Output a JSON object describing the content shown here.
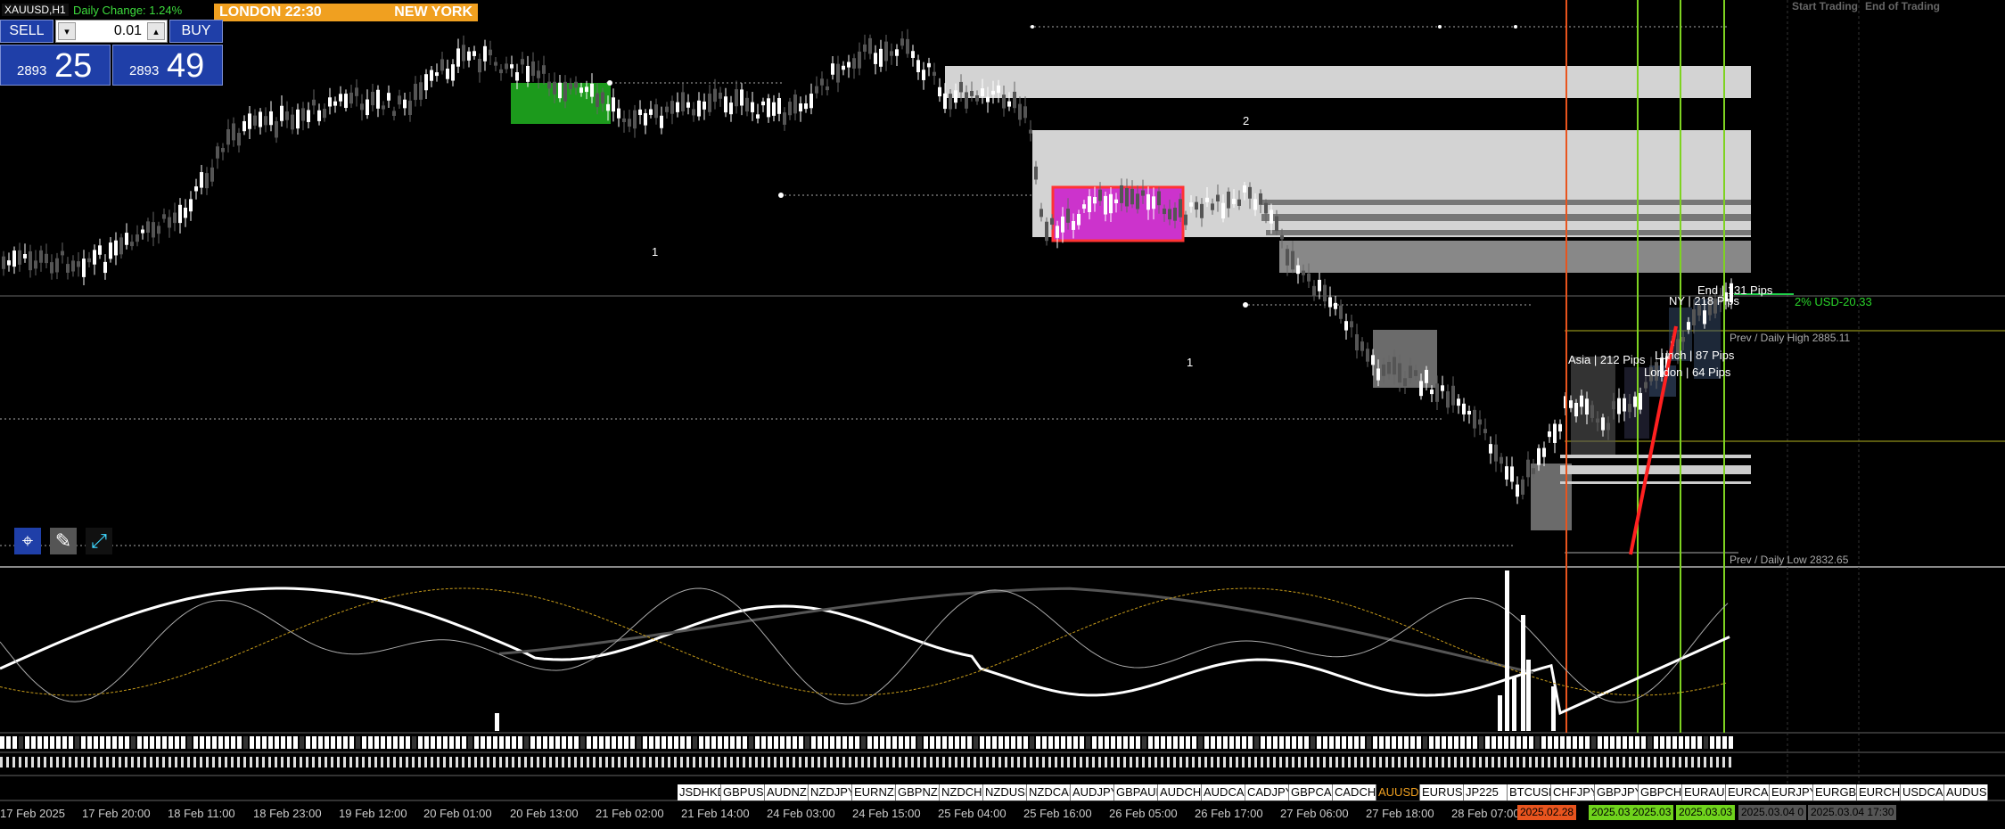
{
  "header": {
    "symbol": "XAUUSD,H1",
    "daily_change": "Daily Change: 1.24%",
    "session_left": "LONDON 22:30",
    "session_right": "NEW YORK"
  },
  "trade_panel": {
    "sell_label": "SELL",
    "buy_label": "BUY",
    "lot_value": "0.01",
    "down_glyph": "▾",
    "up_glyph": "▴",
    "sell_price_small": "2893",
    "sell_price_big": "25",
    "buy_price_small": "2893",
    "buy_price_big": "49"
  },
  "session_headers": {
    "start": "Start Trading",
    "end": "End of Trading"
  },
  "chart_labels": {
    "zone_number_1": "2",
    "zone_number_2": "1",
    "zone_number_3": "1",
    "asia": "Asia | 212 Pips",
    "london": "London | 64 Pips",
    "lunch": "Lunch | 87 Pips",
    "ny": "NY | 218 Pips",
    "end": "End | 131 Pips",
    "risk": "2% USD-20.33",
    "prev_high": "Prev / Daily High 2885.11",
    "prev_low": "Prev / Daily Low 2832.65"
  },
  "tools": [
    {
      "name": "crosshair-icon",
      "glyph": "⌖"
    },
    {
      "name": "draw-tool-icon",
      "glyph": "✎"
    },
    {
      "name": "chart-expand-icon",
      "glyph": "⤢"
    }
  ],
  "pairs": [
    "JSDHKD",
    "GBPUSD",
    "AUDNZD",
    "NZDJPY",
    "EURNZD",
    "GBPNZD",
    "NZDCHF",
    "NZDUSD",
    "NZDCAD",
    "AUDJPY",
    "GBPAUD",
    "AUDCHF",
    "AUDCAD",
    "CADJPY",
    "GBPCAD",
    "CADCHF",
    "AUUSD",
    "EURUSD",
    "JP225",
    "BTCUSD",
    "CHFJPY",
    "GBPJPY",
    "GBPCHF",
    "EURAUD",
    "EURCAD",
    "EURJPY",
    "EURGBP",
    "EURCHF",
    "USDCAD",
    "AUDUSD"
  ],
  "active_pair": "AUUSD",
  "time_axis": [
    "17 Feb 2025",
    "17 Feb 20:00",
    "18 Feb 11:00",
    "18 Feb 23:00",
    "19 Feb 12:00",
    "20 Feb 01:00",
    "20 Feb 13:00",
    "21 Feb 02:00",
    "21 Feb 14:00",
    "24 Feb 03:00",
    "24 Feb 15:00",
    "25 Feb 04:00",
    "25 Feb 16:00",
    "26 Feb 05:00",
    "26 Feb 17:00",
    "27 Feb 06:00",
    "27 Feb 18:00",
    "28 Feb 07:00"
  ],
  "date_tags": [
    {
      "text": "2025.02.28",
      "color": "#e8541e"
    },
    {
      "text": "2025.03",
      "color": "#6fd31c"
    },
    {
      "text": "2025.03",
      "color": "#6fd31c"
    },
    {
      "text": "2025.03.03",
      "color": "#6fd31c"
    },
    {
      "text": "2025.03.04 0",
      "color": "#555555"
    },
    {
      "text": "2025.03.04 17:30",
      "color": "#555555"
    }
  ],
  "colors": {
    "background": "#000000",
    "bull_candle": "#ffffff",
    "bear_candle": "#555555",
    "orange_line": "#e8541e",
    "green_line": "#7ed321",
    "demand_zone": "#cc33cc",
    "green_zone": "#1c9a1c",
    "gray_zone": "#d3d3d3",
    "accent_blue": "#1f3fa8"
  }
}
